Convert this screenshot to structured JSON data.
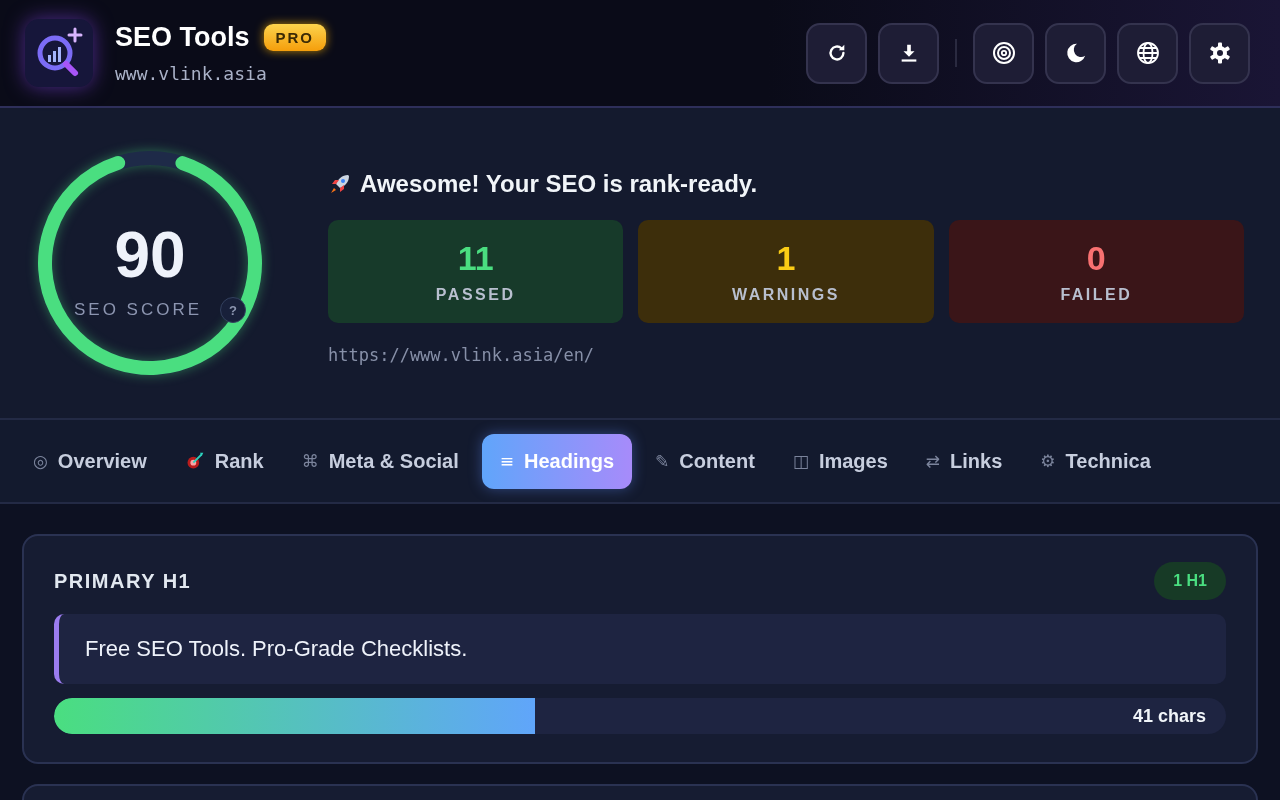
{
  "app": {
    "title": "SEO Tools",
    "badge": "PRO",
    "site": "www.vlink.asia"
  },
  "score": {
    "value": "90",
    "label": "SEO SCORE",
    "help": "?",
    "level": 0.9
  },
  "summary": {
    "headline": "Awesome! Your SEO is rank-ready.",
    "url": "https://www.vlink.asia/en/"
  },
  "stats": [
    {
      "kind": "passed",
      "count": "11",
      "label": "PASSED"
    },
    {
      "kind": "warning",
      "count": "1",
      "label": "WARNINGS"
    },
    {
      "kind": "failed",
      "count": "0",
      "label": "FAILED"
    }
  ],
  "tabs": [
    {
      "glyph": "◎",
      "label": "Overview",
      "selected": false
    },
    {
      "kind": "dart",
      "label": "Rank",
      "selected": false
    },
    {
      "glyph": "⌘",
      "label": "Meta & Social",
      "selected": false
    },
    {
      "glyph": "≡",
      "label": "Headings",
      "selected": true
    },
    {
      "glyph": "✎",
      "label": "Content",
      "selected": false
    },
    {
      "glyph": "◫",
      "label": "Images",
      "selected": false
    },
    {
      "glyph": "⇄",
      "label": "Links",
      "selected": false
    },
    {
      "glyph": "⚙",
      "label": "Technica",
      "selected": false
    }
  ],
  "primary_h1": {
    "title": "PRIMARY H1",
    "badge": "1 H1",
    "text": "Free SEO Tools. Pro-Grade Checklists.",
    "level": 0.41,
    "reading": "41 chars"
  }
}
